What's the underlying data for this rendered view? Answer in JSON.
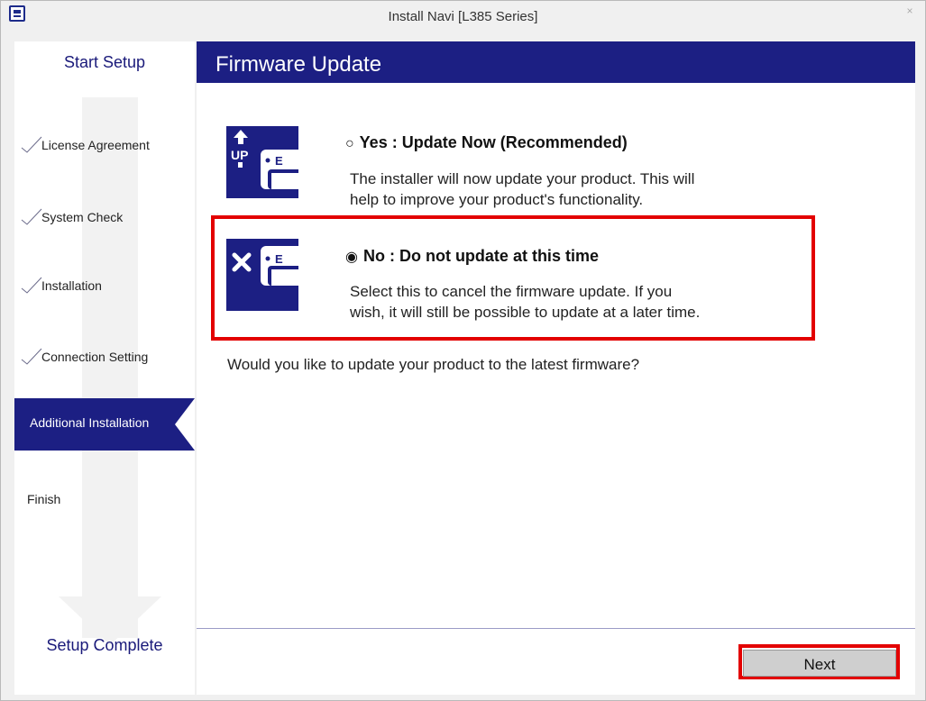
{
  "window": {
    "title": "Install Navi [L385 Series]",
    "close_glyph": "×"
  },
  "sidebar": {
    "header": "Start Setup",
    "footer": "Setup Complete",
    "steps": [
      {
        "label": "License Agreement",
        "status": "done"
      },
      {
        "label": "System Check",
        "status": "done"
      },
      {
        "label": "Installation",
        "status": "done"
      },
      {
        "label": "Connection Setting",
        "status": "done"
      },
      {
        "label": "Additional Installation",
        "status": "active"
      },
      {
        "label": "Finish",
        "status": "pending"
      }
    ]
  },
  "main": {
    "title": "Firmware Update",
    "options": [
      {
        "radio": "○",
        "title": "Yes : Update Now (Recommended)",
        "desc_line1": "The installer will now update your product. This will",
        "desc_line2": "help to improve your product's functionality.",
        "icon_text": "UP",
        "selected": false
      },
      {
        "radio": "◉",
        "title": "No : Do not update at this time",
        "desc_line1": "Select this to cancel the firmware update.  If you",
        "desc_line2": "wish, it will still be possible to update at a later time.",
        "icon_text": "✕",
        "selected": true
      }
    ],
    "question": "Would you like to update your product to the latest firmware?",
    "next_label": "Next"
  },
  "colors": {
    "brand_navy": "#1c1f83",
    "highlight_red": "#e30000",
    "sidebar_bg": "#ffffff",
    "arrow_gray": "#f2f2f2"
  }
}
